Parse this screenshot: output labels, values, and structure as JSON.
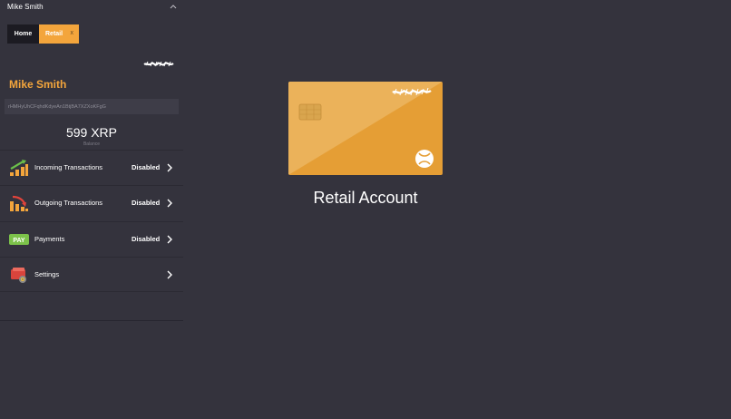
{
  "header": {
    "user_name": "Mike Smith"
  },
  "tabs": [
    {
      "label": "Home",
      "active": false
    },
    {
      "label": "Retail",
      "active": true,
      "close_glyph": "x"
    }
  ],
  "profile": {
    "name": "Mike Smith",
    "address": "rHMHyUhCFqhdKdyeAn1BtjBA7XZXoKFgG",
    "balance": "599 XRP",
    "balance_label": "Balance"
  },
  "menu": [
    {
      "label": "Incoming Transactions",
      "status": "Disabled",
      "icon": "incoming-chart-icon"
    },
    {
      "label": "Outgoing Transactions",
      "status": "Disabled",
      "icon": "outgoing-chart-icon"
    },
    {
      "label": "Payments",
      "status": "Disabled",
      "icon": "pay-icon",
      "icon_text": "PAY"
    },
    {
      "label": "Settings",
      "status": "",
      "icon": "settings-wallet-icon"
    }
  ],
  "account": {
    "title": "Retail Account"
  },
  "colors": {
    "background": "#34333d",
    "accent": "#f3a53c",
    "card": "#e59e35"
  }
}
